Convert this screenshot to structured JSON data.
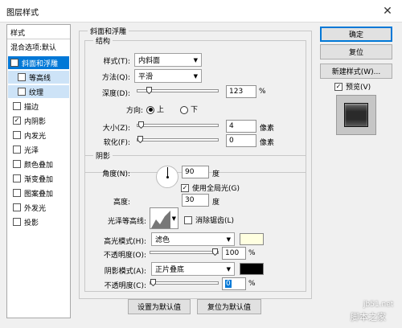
{
  "window": {
    "title": "图层样式"
  },
  "sidebar": {
    "header": "样式",
    "blend_options": "混合选项:默认",
    "items": [
      {
        "label": "斜面和浮雕",
        "checked": true,
        "selected": true
      },
      {
        "label": "等高线",
        "checked": false,
        "selected": true,
        "indent": true
      },
      {
        "label": "纹理",
        "checked": false,
        "selected": true,
        "indent": true
      },
      {
        "label": "描边",
        "checked": false
      },
      {
        "label": "内阴影",
        "checked": true
      },
      {
        "label": "内发光",
        "checked": false
      },
      {
        "label": "光泽",
        "checked": false
      },
      {
        "label": "颜色叠加",
        "checked": false
      },
      {
        "label": "渐变叠加",
        "checked": false
      },
      {
        "label": "图案叠加",
        "checked": false
      },
      {
        "label": "外发光",
        "checked": false
      },
      {
        "label": "投影",
        "checked": false
      }
    ]
  },
  "bevel": {
    "title": "斜面和浮雕",
    "structure": {
      "title": "结构",
      "style_label": "样式(T):",
      "style_value": "内斜面",
      "method_label": "方法(Q):",
      "method_value": "平滑",
      "depth_label": "深度(D):",
      "depth_value": "123",
      "depth_unit": "%",
      "depth_level": 123,
      "direction_label": "方向:",
      "direction_up": "上",
      "direction_down": "下",
      "direction_selected": "up",
      "size_label": "大小(Z):",
      "size_value": "4",
      "size_unit": "像素",
      "size_level": 4,
      "soften_label": "软化(F):",
      "soften_value": "0",
      "soften_unit": "像素",
      "soften_level": 0
    },
    "shading": {
      "title": "阴影",
      "angle_label": "角度(N):",
      "angle_value": "90",
      "angle_unit": "度",
      "global_light_label": "使用全局光(G)",
      "global_light_checked": true,
      "altitude_label": "高度:",
      "altitude_value": "30",
      "altitude_unit": "度",
      "gloss_label": "光泽等高线:",
      "antialias_label": "消除锯齿(L)",
      "antialias_checked": false,
      "highlight_mode_label": "高光模式(H):",
      "highlight_mode_value": "滤色",
      "highlight_color": "#ffffe0",
      "highlight_opacity_label": "不透明度(O):",
      "highlight_opacity_value": "100",
      "highlight_opacity_unit": "%",
      "highlight_opacity_level": 100,
      "shadow_mode_label": "阴影模式(A):",
      "shadow_mode_value": "正片叠底",
      "shadow_color": "#000000",
      "shadow_opacity_label": "不透明度(C):",
      "shadow_opacity_value": "0",
      "shadow_opacity_unit": "%",
      "shadow_opacity_level": 0
    },
    "set_default_label": "设置为默认值",
    "reset_default_label": "复位为默认值"
  },
  "actions": {
    "ok_label": "确定",
    "reset_label": "复位",
    "new_style_label": "新建样式(W)...",
    "preview_label": "预览(V)",
    "preview_checked": true
  },
  "watermark": {
    "site": "jb51.net",
    "brand": "脚本之家"
  },
  "colors": {
    "selected_bg": "#0078d7",
    "accent": "#0078d7"
  }
}
